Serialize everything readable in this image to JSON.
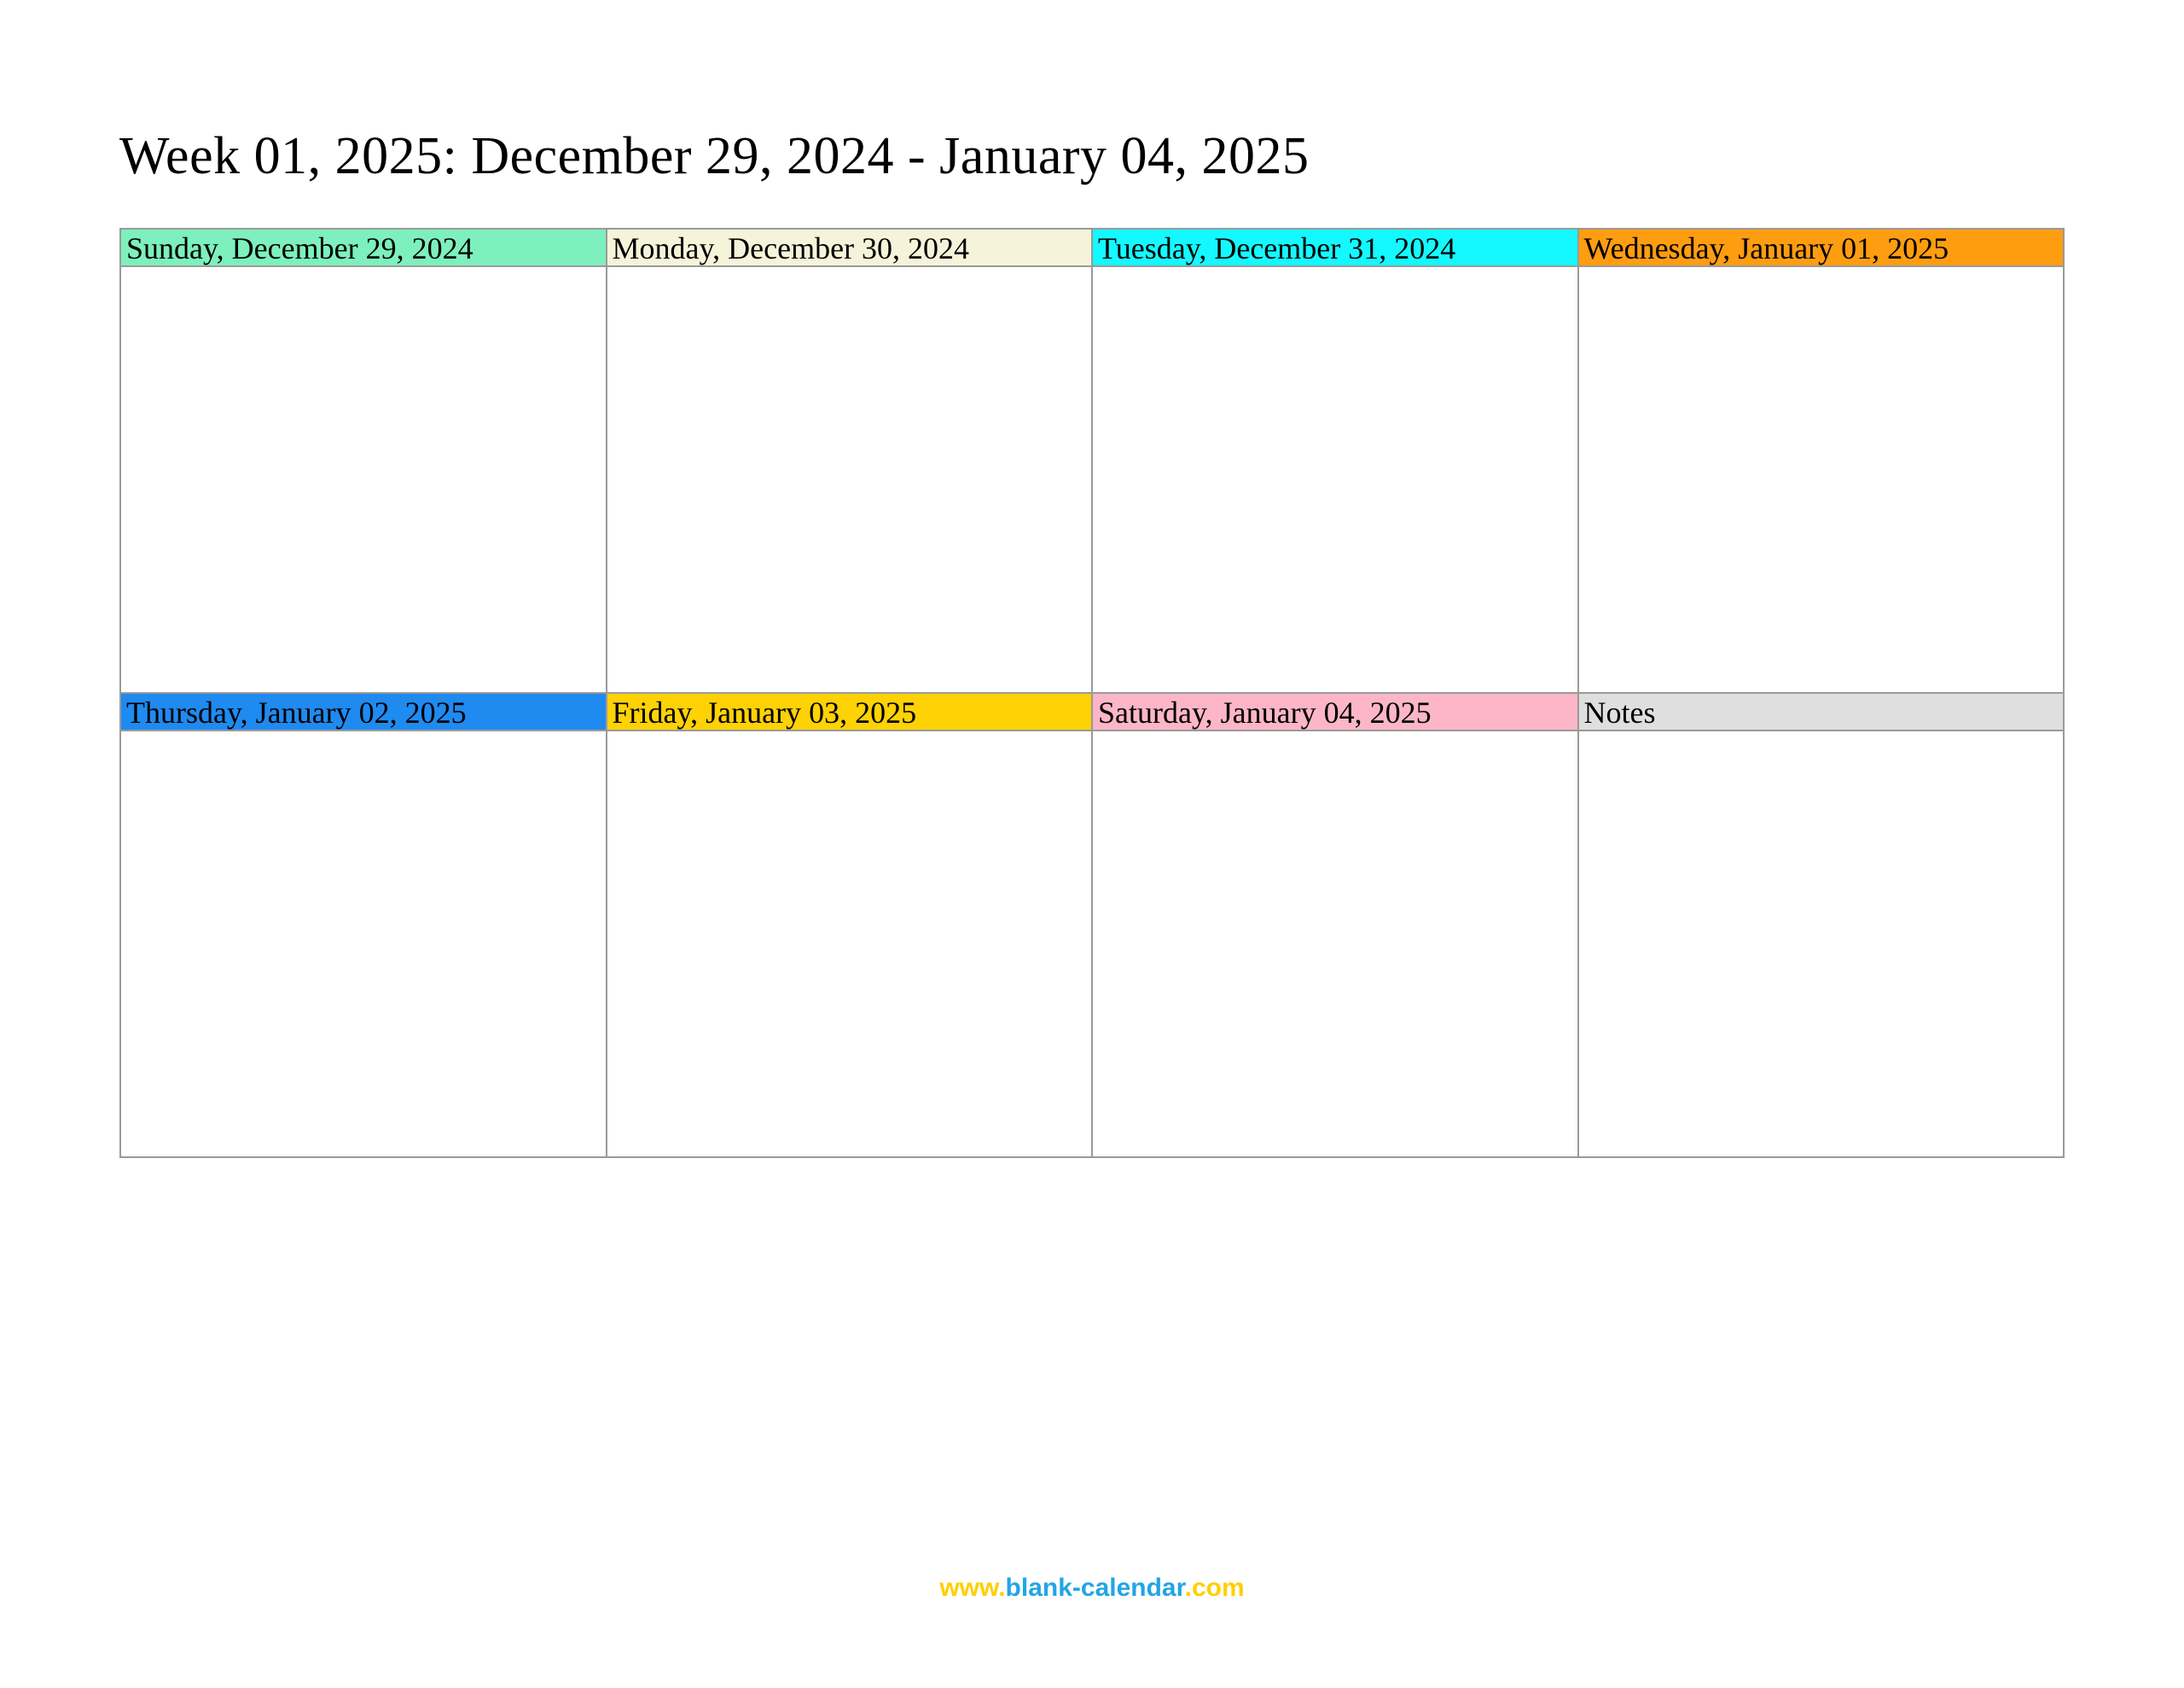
{
  "title": "Week 01, 2025: December 29, 2024 - January 04, 2025",
  "days": {
    "sunday": "Sunday, December 29, 2024",
    "monday": "Monday, December 30, 2024",
    "tuesday": "Tuesday, December 31, 2024",
    "wednesday": "Wednesday, January 01, 2025",
    "thursday": "Thursday, January 02, 2025",
    "friday": "Friday, January 03, 2025",
    "saturday": "Saturday, January 04, 2025",
    "notes": "Notes"
  },
  "footer": {
    "part1": "www.",
    "part2": "blank-calendar",
    "part3": ".com"
  }
}
